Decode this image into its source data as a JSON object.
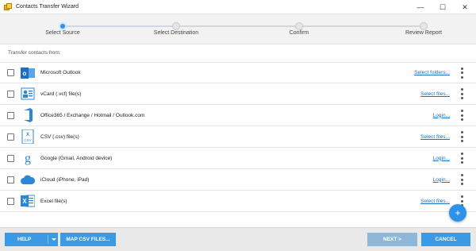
{
  "window": {
    "title": "Contacts Transfer Wizard",
    "controls": [
      "—",
      "☐",
      "✕"
    ]
  },
  "steps": [
    {
      "label": "Select Source",
      "active": true
    },
    {
      "label": "Select Destination",
      "active": false
    },
    {
      "label": "Confirm",
      "active": false
    },
    {
      "label": "Review Report",
      "active": false
    }
  ],
  "section_label": "Transfer contacts from:",
  "sources": [
    {
      "label": "Microsoft Outlook",
      "action": "Select folders...",
      "icon": "outlook-icon"
    },
    {
      "label": "vCard (.vcf) file(s)",
      "action": "Select files...",
      "icon": "vcard-icon"
    },
    {
      "label": "Office365 / Exchange / Hotmail / Outlook.com",
      "action": "Login...",
      "icon": "office365-icon"
    },
    {
      "label": "CSV (.csv) file(s)",
      "action": "Select files...",
      "icon": "csv-icon"
    },
    {
      "label": "Google (Gmail, Android device)",
      "action": "Login...",
      "icon": "google-icon"
    },
    {
      "label": "iCloud (iPhone, iPad)",
      "action": "Login...",
      "icon": "icloud-icon"
    },
    {
      "label": "Excel file(s)",
      "action": "Select files...",
      "icon": "excel-icon"
    }
  ],
  "fab": {
    "label": "+"
  },
  "footer": {
    "help": "HELP",
    "map_csv": "MAP CSV FILES...",
    "next": "NEXT >",
    "cancel": "CANCEL"
  },
  "colors": {
    "accent": "#2e93e8",
    "button": "#3a9ae6",
    "button_disabled": "#8fb8d8",
    "link": "#1b6fc4"
  }
}
